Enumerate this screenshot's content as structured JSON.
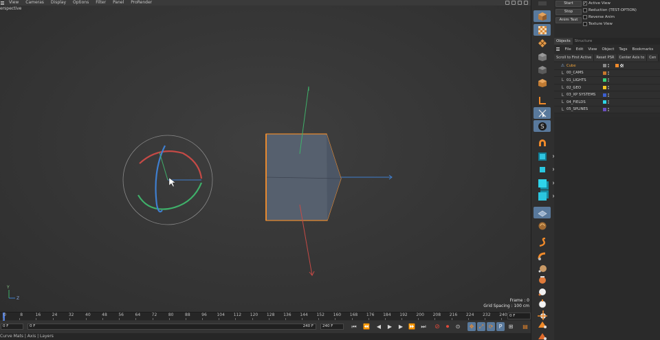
{
  "viewport_menu": [
    "View",
    "Cameras",
    "Display",
    "Options",
    "Filter",
    "Panel",
    "ProRender"
  ],
  "viewport": {
    "camera_label": "erspective",
    "frame_text": "Frame : 0",
    "grid_spacing_text": "Grid Spacing : 100 cm"
  },
  "timeline": {
    "ticks": [
      "0",
      "8",
      "16",
      "24",
      "32",
      "40",
      "48",
      "56",
      "64",
      "72",
      "80",
      "88",
      "96",
      "104",
      "112",
      "120",
      "128",
      "136",
      "144",
      "152",
      "160",
      "168",
      "176",
      "184",
      "192",
      "200",
      "208",
      "216",
      "224",
      "232",
      "240"
    ],
    "current_frame_right": "0 F"
  },
  "controls": {
    "start_field": "0 F",
    "current_field": "0 F",
    "end_field_a": "240 F",
    "end_field_b": "240 F"
  },
  "statusbar": {
    "text": "Curve   Mats | Axis | Layers"
  },
  "animation_panel": {
    "buttons": [
      "Start",
      "Stop",
      "Anim Test"
    ],
    "checkboxes": [
      {
        "label": "Active View",
        "checked": true
      },
      {
        "label": "Reduction (TEST-OPTION)",
        "checked": false
      },
      {
        "label": "Reverse Anim",
        "checked": false
      },
      {
        "label": "Texture View",
        "checked": false
      }
    ]
  },
  "objects_panel": {
    "tabs": [
      "Objects",
      "Structure"
    ],
    "menu": [
      "File",
      "Edit",
      "View",
      "Object",
      "Tags",
      "Bookmarks"
    ],
    "toolbar": [
      "Scroll to First Active",
      "Reset PSR",
      "Center Axis to",
      "Cen"
    ],
    "rows": [
      {
        "name": "Cube",
        "selected": true,
        "icon": "cube-icon",
        "color": ""
      },
      {
        "name": "00_CAMS",
        "selected": false,
        "icon": "null-icon",
        "color": "#c8782d"
      },
      {
        "name": "01_LIGHTS",
        "selected": false,
        "icon": "null-icon",
        "color": "#38d27a"
      },
      {
        "name": "02_GEO",
        "selected": false,
        "icon": "null-icon",
        "color": "#f2c422"
      },
      {
        "name": "03_XP SYSTEMS",
        "selected": false,
        "icon": "null-icon",
        "color": "#3b5fd0"
      },
      {
        "name": "04_FIELDS",
        "selected": false,
        "icon": "null-icon",
        "color": "#2dd6e6"
      },
      {
        "name": "05_SPLINES",
        "selected": false,
        "icon": "null-icon",
        "color": "#6b4fc0"
      }
    ]
  },
  "colors": {
    "selection_blue": "#59799c",
    "accent_orange": "#f08a2a",
    "axis_red": "#c64a46",
    "axis_green": "#3fb06a",
    "axis_blue": "#3f7fd0"
  }
}
